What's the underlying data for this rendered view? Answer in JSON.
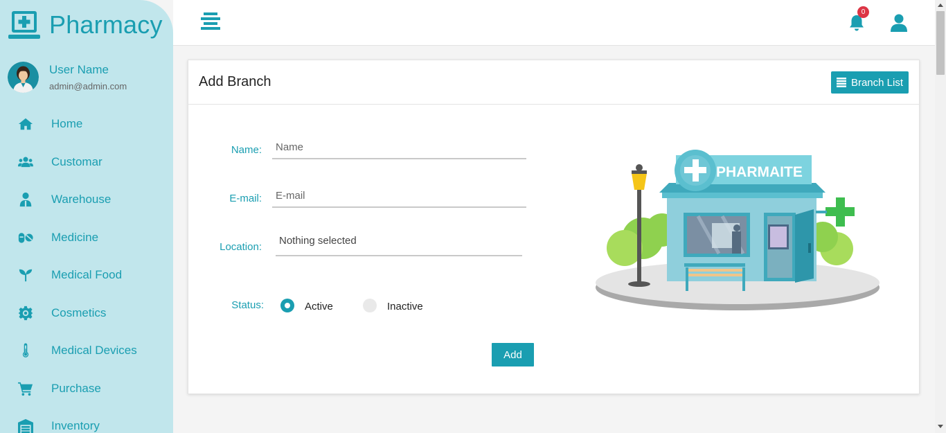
{
  "brand": {
    "name": "Pharmacy",
    "icon": "laptop-medical-icon"
  },
  "profile": {
    "name": "User Name",
    "email": "admin@admin.com"
  },
  "sidebar": {
    "items": [
      {
        "label": "Home",
        "icon": "home-icon"
      },
      {
        "label": "Customar",
        "icon": "users-icon"
      },
      {
        "label": "Warehouse",
        "icon": "user-doctor-icon"
      },
      {
        "label": "Medicine",
        "icon": "pills-icon"
      },
      {
        "label": "Medical Food",
        "icon": "seedling-icon"
      },
      {
        "label": "Cosmetics",
        "icon": "gear-icon"
      },
      {
        "label": "Medical Devices",
        "icon": "thermometer-icon"
      },
      {
        "label": "Purchase",
        "icon": "cart-icon"
      },
      {
        "label": "Inventory",
        "icon": "warehouse-icon"
      }
    ]
  },
  "topbar": {
    "notification_count": "0"
  },
  "card": {
    "title": "Add Branch",
    "list_button": "Branch List"
  },
  "form": {
    "name_label": "Name:",
    "name_placeholder": "Name",
    "email_label": "E-mail:",
    "email_placeholder": "E-mail",
    "location_label": "Location:",
    "location_value": "Nothing selected",
    "status_label": "Status:",
    "status_options": [
      {
        "label": "Active",
        "selected": true
      },
      {
        "label": "Inactive",
        "selected": false
      }
    ],
    "submit_label": "Add"
  },
  "illustration": {
    "sign_text": "PHARMAITE"
  },
  "colors": {
    "accent": "#1a9eb1",
    "sidebar_bg": "#c1e6ec",
    "badge": "#dc3545"
  }
}
